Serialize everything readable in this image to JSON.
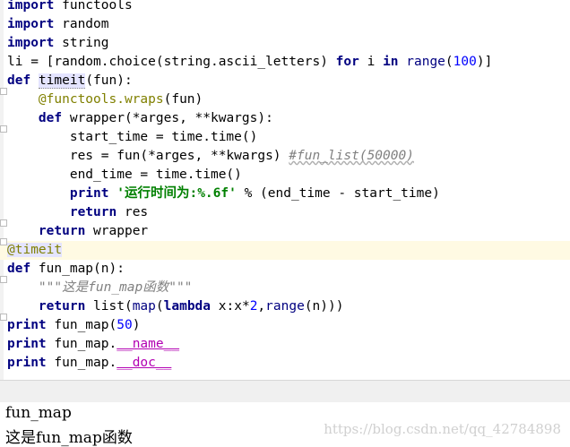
{
  "editor": {
    "lines": [
      [
        "import",
        " functools"
      ],
      [
        "import",
        " random"
      ],
      [
        "import",
        " string"
      ],
      [
        "li = [random.choice(string.ascii_letters) ",
        "for",
        " i ",
        "in",
        " ",
        "range",
        "(",
        "100",
        ")]"
      ],
      [
        "def",
        " ",
        "timeit",
        "(fun):"
      ],
      [
        "    ",
        "@functools.wraps",
        "(fun)"
      ],
      [
        "    ",
        "def",
        " wrapper(*arges, **kwargs):"
      ],
      [
        "        start_time = time.time()"
      ],
      [
        "        res = fun(*arges, **kwargs) ",
        "#fun_list(50000)"
      ],
      [
        "        end_time = time.time()"
      ],
      [
        "        ",
        "print",
        " ",
        "'运行时间为:%.6f'",
        " % (end_time - start_time)"
      ],
      [
        "        ",
        "return",
        " res"
      ],
      [
        "    ",
        "return",
        " wrapper"
      ],
      [
        "@timeit"
      ],
      [
        "def",
        " fun_map(n):"
      ],
      [
        "    ",
        "\"\"\"这是fun_map函数\"\"\""
      ],
      [
        "    ",
        "return",
        " list(",
        "map",
        "(",
        "lambda",
        " x:x*",
        "2",
        ",",
        "range",
        "(n)))"
      ],
      [
        "print",
        " fun_map(",
        "50",
        ")"
      ],
      [
        "print",
        " fun_map.",
        "__name__"
      ],
      [
        "print",
        " fun_map.",
        "__doc__"
      ]
    ]
  },
  "console": {
    "output_lines": [
      "fun_map",
      "这是fun_map函数"
    ]
  },
  "watermark": "https://blog.csdn.net/qq_42784898"
}
